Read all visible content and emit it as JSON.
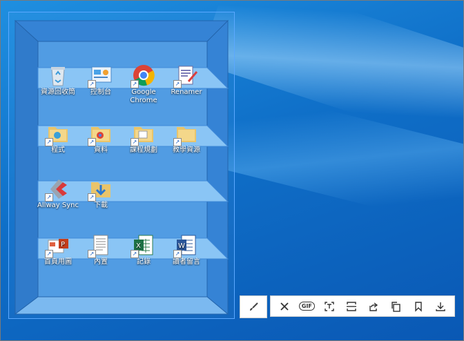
{
  "desktop": {
    "icons": [
      {
        "id": "recycle",
        "label": "資源回收筒",
        "kind": "recycle-bin-icon",
        "shortcut": false
      },
      {
        "id": "control",
        "label": "控制台",
        "kind": "control-panel-icon",
        "shortcut": true
      },
      {
        "id": "chrome",
        "label": "Google Chrome",
        "kind": "chrome-icon",
        "shortcut": true
      },
      {
        "id": "renamer",
        "label": "Renamer",
        "kind": "renamer-icon",
        "shortcut": true
      },
      {
        "id": "programs",
        "label": "程式",
        "kind": "folder-icon",
        "shortcut": true
      },
      {
        "id": "data",
        "label": "資料",
        "kind": "folder-icon",
        "shortcut": true
      },
      {
        "id": "course",
        "label": "課程規劃",
        "kind": "folder-icon",
        "shortcut": true
      },
      {
        "id": "teaching",
        "label": "教學資源",
        "kind": "folder-icon",
        "shortcut": true
      },
      {
        "id": "allway",
        "label": "Allway Sync",
        "kind": "allway-sync-icon",
        "shortcut": true
      },
      {
        "id": "download",
        "label": "下載",
        "kind": "download-folder-icon",
        "shortcut": true
      },
      {
        "id": "homepage",
        "label": "首頁用圖",
        "kind": "powerpoint-icon",
        "shortcut": true
      },
      {
        "id": "content",
        "label": "內置",
        "kind": "document-icon",
        "shortcut": true
      },
      {
        "id": "records",
        "label": "記錄",
        "kind": "excel-icon",
        "shortcut": true
      },
      {
        "id": "messages",
        "label": "讀者留言",
        "kind": "word-icon",
        "shortcut": true
      }
    ]
  },
  "toolbar": {
    "brush": "brush-icon",
    "buttons": [
      "close-icon",
      "gif-icon",
      "text-ocr-icon",
      "scroll-capture-icon",
      "share-icon",
      "copy-icon",
      "bookmark-icon",
      "download-icon"
    ],
    "gif_label": "GIF"
  },
  "colors": {
    "desktop": "#0f6fc8",
    "shelf_back": "#4b98e0",
    "shelf_board": "#8cc6f5",
    "shelf_side": "#2f7fd2"
  }
}
